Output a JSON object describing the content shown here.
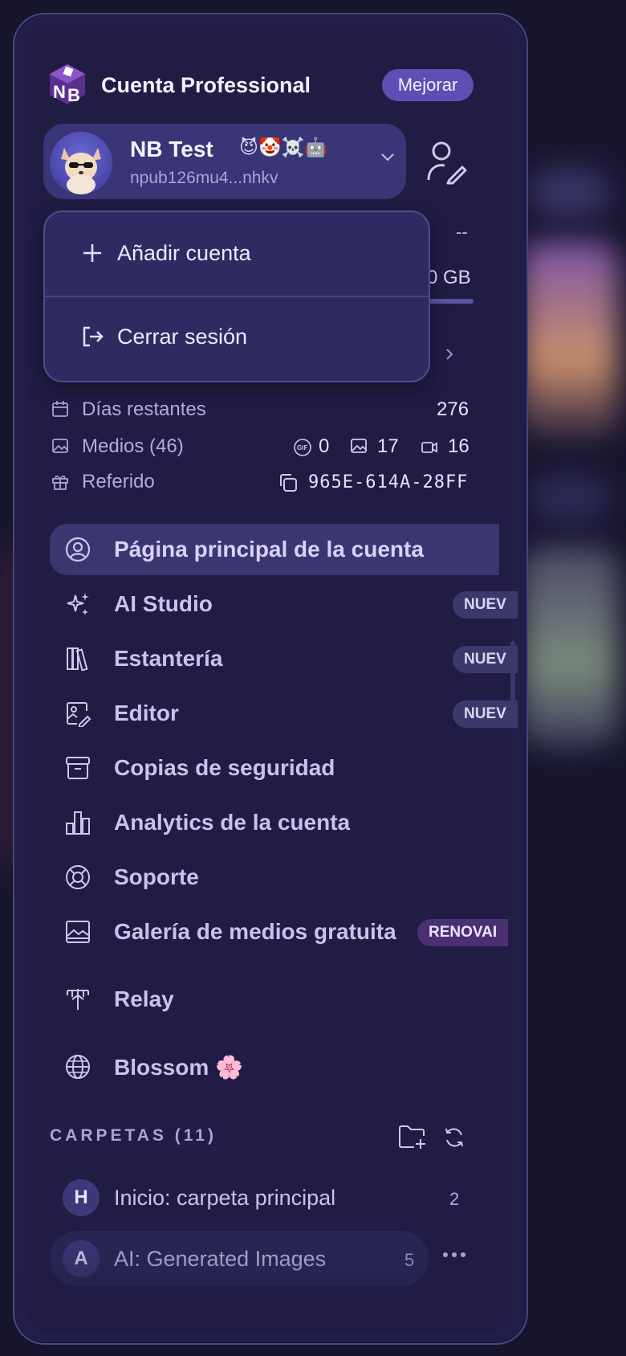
{
  "header": {
    "account_title": "Cuenta Professional",
    "upgrade_label": "Mejorar"
  },
  "user": {
    "name": "NB Test",
    "emojis": "😈🤡☠️🤖",
    "npub": "npub126mu4...nhkv"
  },
  "dropdown": {
    "add_account": "Añadir cuenta",
    "logout": "Cerrar sesión"
  },
  "storage": {
    "partial_dash": "--",
    "partial_gb": "0 GB"
  },
  "stats": {
    "days_label": "Días restantes",
    "days_value": "276",
    "media_label": "Medios (46)",
    "gif_count": "0",
    "image_count": "17",
    "video_count": "16",
    "referral_label": "Referido",
    "referral_code": "965E-614A-28FF"
  },
  "nav": [
    {
      "label": "Página principal de la cuenta",
      "icon": "user-circle-icon",
      "active": true
    },
    {
      "label": "AI Studio",
      "icon": "sparkles-icon",
      "badge": "NUEV"
    },
    {
      "label": "Estantería",
      "icon": "books-icon",
      "badge": "NUEV"
    },
    {
      "label": "Editor",
      "icon": "image-edit-icon",
      "badge": "NUEV"
    },
    {
      "label": "Copias de seguridad",
      "icon": "archive-icon"
    },
    {
      "label": "Analytics de la cuenta",
      "icon": "bar-chart-icon"
    },
    {
      "label": "Soporte",
      "icon": "lifebuoy-icon"
    },
    {
      "label": "Galería de medios gratuita",
      "icon": "gallery-icon",
      "badge": "RENOVAI"
    },
    {
      "label": "Relay",
      "icon": "antenna-icon"
    },
    {
      "label": "Blossom 🌸",
      "icon": "globe-icon"
    }
  ],
  "folders": {
    "title": "CARPETAS (11)",
    "items": [
      {
        "avatar": "H",
        "label": "Inicio: carpeta principal",
        "count": "2"
      },
      {
        "avatar": "A",
        "label": "AI: Generated Images",
        "count": "5"
      }
    ]
  },
  "colors": {
    "background": "#17152e",
    "panel": "#221e48",
    "accent": "#5d4fb4",
    "active_item": "#3b3672"
  }
}
